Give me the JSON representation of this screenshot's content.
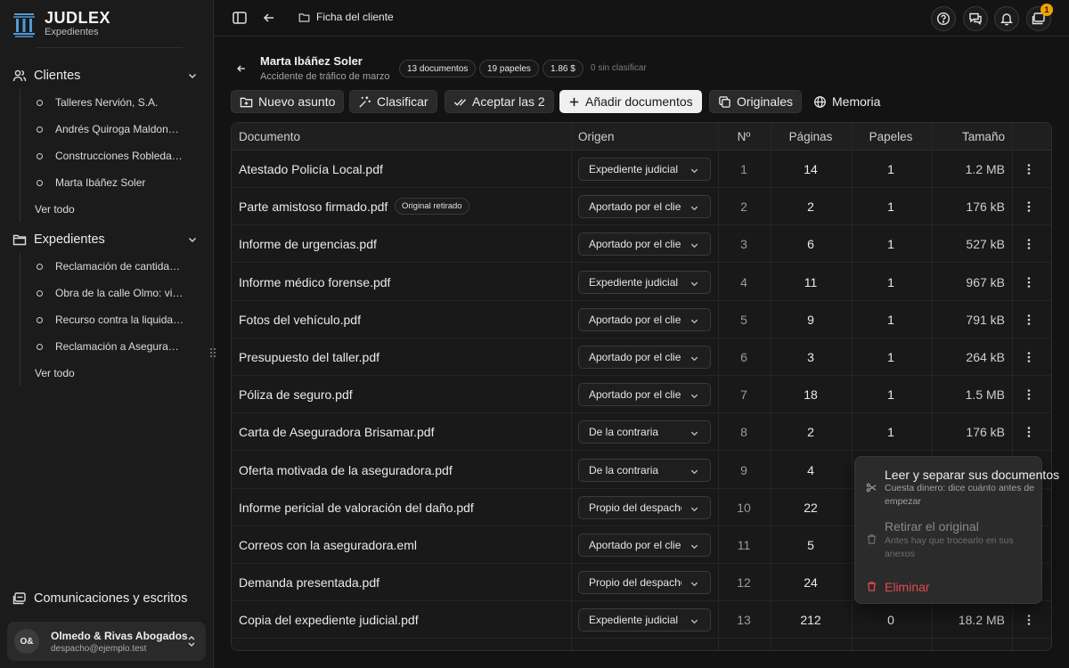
{
  "brand": {
    "name": "JUDLEX",
    "subtitle": "Expedientes"
  },
  "sidebar": {
    "clients_label": "Clientes",
    "clients": [
      "Talleres Nervión, S.A.",
      "Andrés Quiroga Maldonado",
      "Construcciones Robledal S.L.",
      "Marta Ibáñez Soler"
    ],
    "clients_all": "Ver todo",
    "cases_label": "Expedientes",
    "cases": [
      "Reclamación de cantidad contra",
      "Obra de la calle Olmo: vicios",
      "Recurso contra la liquidación",
      "Reclamación a Aseguradora"
    ],
    "cases_all": "Ver todo",
    "communications_label": "Comunicaciones y escritos",
    "account": {
      "initials": "O&",
      "org": "Olmedo & Rivas Abogados",
      "email": "despacho@ejemplo.test"
    }
  },
  "topbar": {
    "breadcrumb": "Ficha del cliente",
    "notifications_count": "1"
  },
  "client": {
    "name": "Marta Ibáñez Soler",
    "case": "Accidente de tráfico de marzo",
    "pills": [
      "13 documentos",
      "19 papeles",
      "1.86 $"
    ],
    "unclassified": "0 sin clasificar"
  },
  "toolbar": {
    "new_matter": "Nuevo asunto",
    "classify": "Clasificar",
    "accept": "Aceptar las 2",
    "add_docs": "Añadir documentos",
    "originals": "Originales",
    "memory": "Memoria"
  },
  "table": {
    "headers": {
      "document": "Documento",
      "origin": "Origen",
      "number": "Nº",
      "pages": "Páginas",
      "papers": "Papeles",
      "size": "Tamaño"
    },
    "rows": [
      {
        "name": "Atestado Policía Local.pdf",
        "origin": "Expediente judicial",
        "n": "1",
        "pages": "14",
        "papers": "1",
        "size": "1.2 MB"
      },
      {
        "name": "Parte amistoso firmado.pdf",
        "badge": "Original retirado",
        "origin": "Aportado por el cliente",
        "n": "2",
        "pages": "2",
        "papers": "1",
        "size": "176 kB"
      },
      {
        "name": "Informe de urgencias.pdf",
        "origin": "Aportado por el cliente",
        "n": "3",
        "pages": "6",
        "papers": "1",
        "size": "527 kB"
      },
      {
        "name": "Informe médico forense.pdf",
        "origin": "Expediente judicial",
        "n": "4",
        "pages": "11",
        "papers": "1",
        "size": "967 kB"
      },
      {
        "name": "Fotos del vehículo.pdf",
        "origin": "Aportado por el cliente",
        "n": "5",
        "pages": "9",
        "papers": "1",
        "size": "791 kB"
      },
      {
        "name": "Presupuesto del taller.pdf",
        "origin": "Aportado por el cliente",
        "n": "6",
        "pages": "3",
        "papers": "1",
        "size": "264 kB"
      },
      {
        "name": "Póliza de seguro.pdf",
        "origin": "Aportado por el cliente",
        "n": "7",
        "pages": "18",
        "papers": "1",
        "size": "1.5 MB"
      },
      {
        "name": "Carta de Aseguradora Brisamar.pdf",
        "origin": "De la contraria",
        "n": "8",
        "pages": "2",
        "papers": "1",
        "size": "176 kB"
      },
      {
        "name": "Oferta motivada de la aseguradora.pdf",
        "origin": "De la contraria",
        "n": "9",
        "pages": "4",
        "papers": "",
        "size": ""
      },
      {
        "name": "Informe pericial de valoración del daño.pdf",
        "origin": "Propio del despacho",
        "n": "10",
        "pages": "22",
        "papers": "",
        "size": ""
      },
      {
        "name": "Correos con la aseguradora.eml",
        "origin": "Aportado por el cliente",
        "n": "11",
        "pages": "5",
        "papers": "",
        "size": ""
      },
      {
        "name": "Demanda presentada.pdf",
        "origin": "Propio del despacho",
        "n": "12",
        "pages": "24",
        "papers": "",
        "size": ""
      },
      {
        "name": "Copia del expediente judicial.pdf",
        "origin": "Expediente judicial",
        "n": "13",
        "pages": "212",
        "papers": "0",
        "size": "18.2 MB"
      }
    ]
  },
  "context_menu": {
    "split_title": "Leer y separar sus documentos",
    "split_desc": "Cuesta dinero: dice cuánto antes de empezar",
    "withdraw_title": "Retirar el original",
    "withdraw_desc": "Antes hay que trocearlo en sus anexos",
    "delete_title": "Eliminar",
    "delete_color": "#e5484d"
  }
}
